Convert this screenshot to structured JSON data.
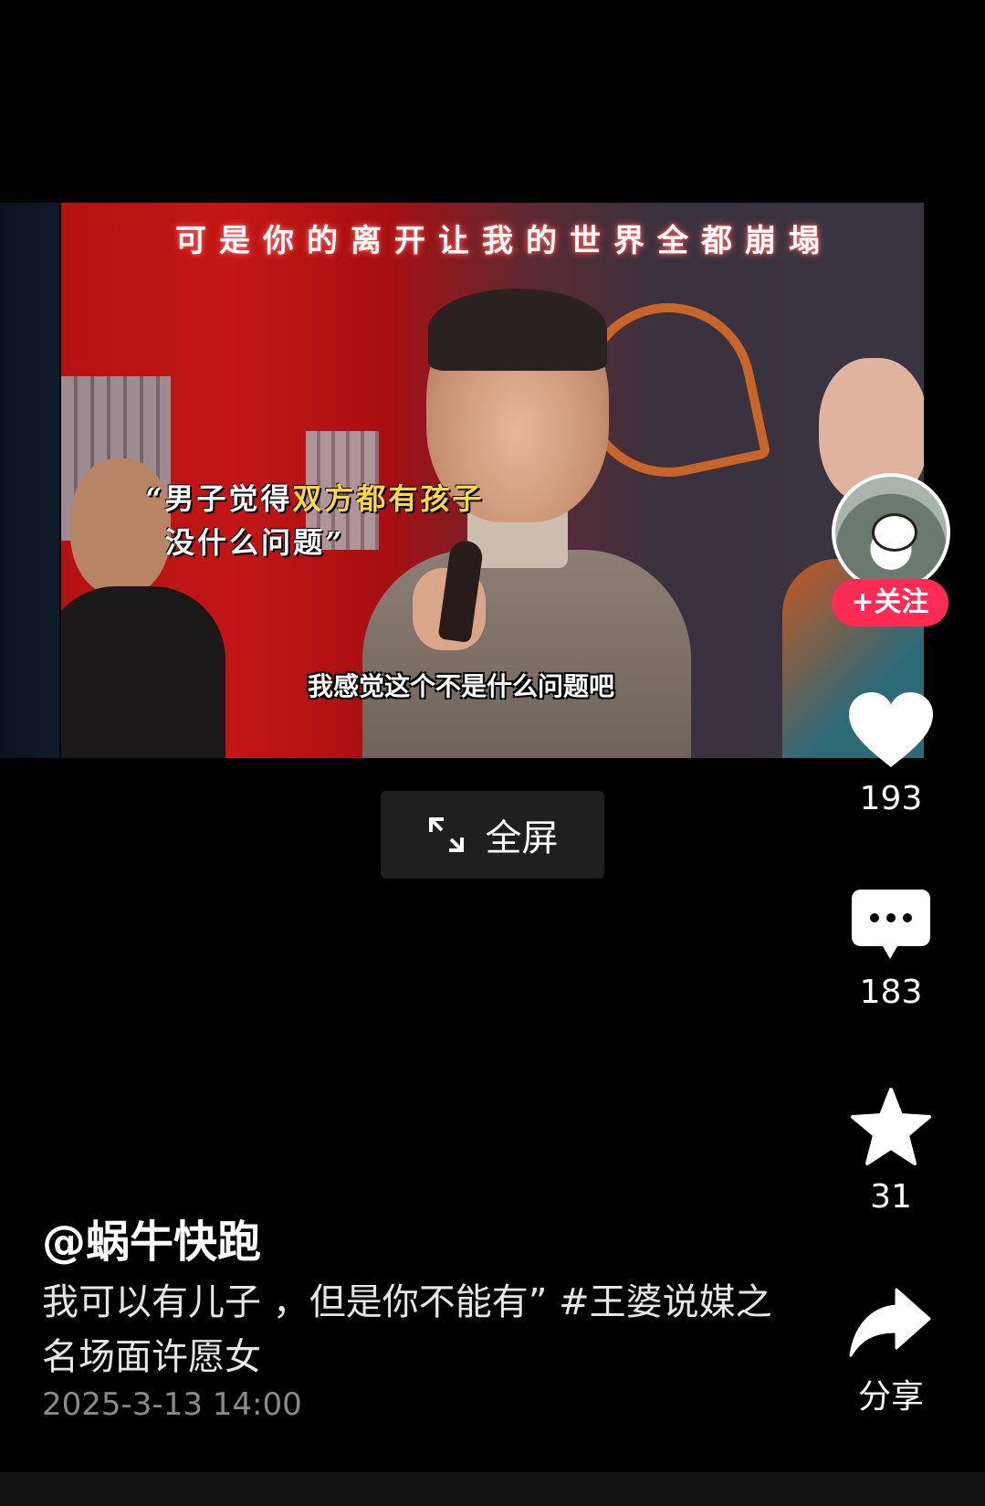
{
  "video": {
    "caption_top": "可是你的离开让我的世界全都崩塌",
    "caption_quote_line1_pre": "“男子觉得",
    "caption_quote_line1_hl": "双方都有孩子",
    "caption_quote_line2": "没什么问题”",
    "subtitle": "我感觉这个不是什么问题吧",
    "fullscreen_label": "全屏"
  },
  "sidebar": {
    "follow_label": "+关注",
    "like_count": "193",
    "comment_count": "183",
    "favorite_count": "31",
    "share_label": "分享"
  },
  "post": {
    "author": "@蜗牛快跑",
    "description": "我可以有儿子 ，但是你不能有” #王婆说媒之名场面许愿女",
    "date": "2025-3-13 14:00"
  },
  "colors": {
    "follow": "#fe2c55",
    "background": "#000000",
    "subtitle_highlight": "#ffd84a"
  }
}
